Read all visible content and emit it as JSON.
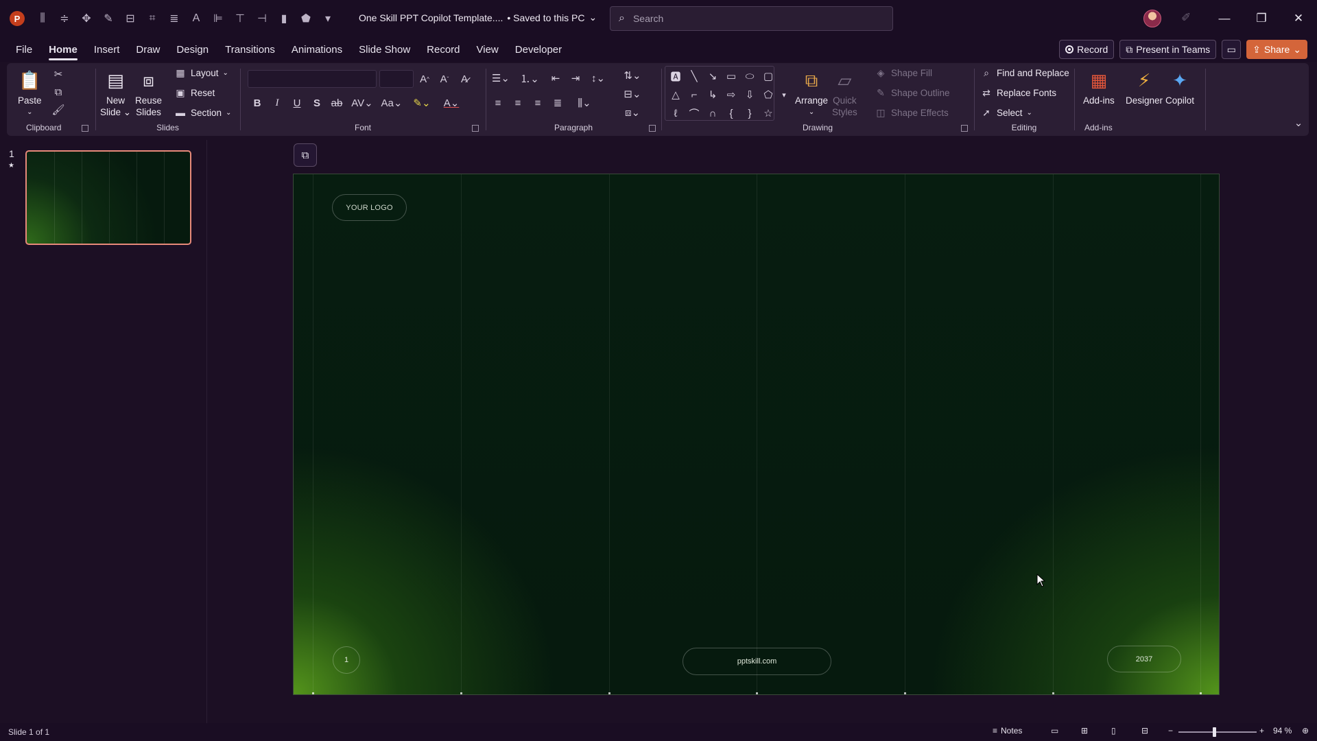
{
  "app": {
    "logo_letter": "P",
    "doc_title": "One Skill PPT Copilot Template....",
    "save_status": "• Saved to this PC"
  },
  "search": {
    "placeholder": "Search"
  },
  "menu": {
    "tabs": [
      "File",
      "Home",
      "Insert",
      "Draw",
      "Design",
      "Transitions",
      "Animations",
      "Slide Show",
      "Record",
      "View",
      "Developer"
    ],
    "active": "Home",
    "record_button": "Record",
    "present_button": "Present in Teams",
    "share_button": "Share"
  },
  "ribbon": {
    "clipboard": {
      "label": "Clipboard",
      "paste": "Paste"
    },
    "slides": {
      "label": "Slides",
      "new_slide_line1": "New",
      "new_slide_line2": "Slide",
      "reuse_line1": "Reuse",
      "reuse_line2": "Slides",
      "layout": "Layout",
      "reset": "Reset",
      "section": "Section"
    },
    "font": {
      "label": "Font",
      "font_name": "",
      "font_size": ""
    },
    "paragraph": {
      "label": "Paragraph"
    },
    "drawing": {
      "label": "Drawing",
      "arrange": "Arrange",
      "quick_styles_line1": "Quick",
      "quick_styles_line2": "Styles",
      "shape_fill": "Shape Fill",
      "shape_outline": "Shape Outline",
      "shape_effects": "Shape Effects"
    },
    "editing": {
      "label": "Editing",
      "find_replace": "Find and Replace",
      "replace_fonts": "Replace Fonts",
      "select": "Select"
    },
    "addins": {
      "label": "Add-ins",
      "addins_btn": "Add-ins",
      "designer": "Designer",
      "copilot": "Copilot"
    }
  },
  "thumbnails": [
    {
      "number": "1"
    }
  ],
  "slide": {
    "logo_text": "YOUR LOGO",
    "page_number": "1",
    "url": "pptskill.com",
    "year": "2037"
  },
  "status": {
    "slide_info": "Slide 1 of 1",
    "notes": "Notes",
    "zoom": "94 %"
  },
  "colors": {
    "accent": "#c43e1c",
    "share": "#d4653a",
    "slide_green": "#62aa1e",
    "slide_dark": "#061a0e"
  }
}
